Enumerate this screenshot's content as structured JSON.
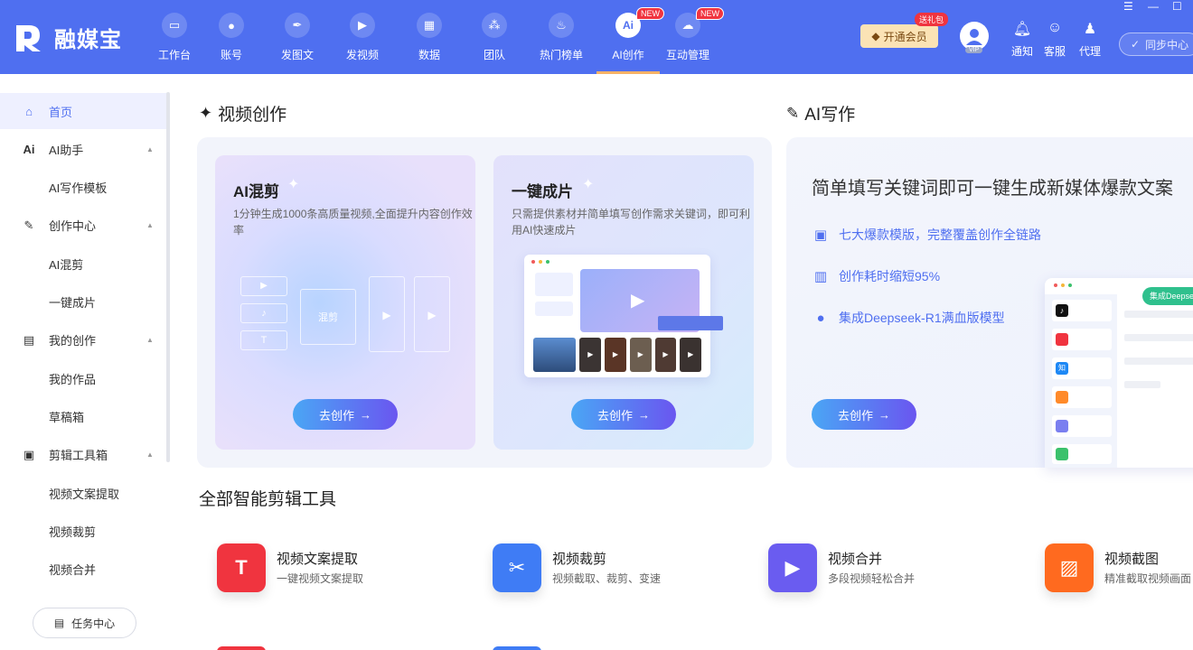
{
  "app": {
    "name": "融媒宝"
  },
  "nav": [
    {
      "label": "工作台",
      "icon": "monitor-icon"
    },
    {
      "label": "账号",
      "icon": "user-icon"
    },
    {
      "label": "发图文",
      "icon": "feather-icon"
    },
    {
      "label": "发视频",
      "icon": "play-icon"
    },
    {
      "label": "数据",
      "icon": "chart-icon"
    },
    {
      "label": "团队",
      "icon": "team-icon"
    },
    {
      "label": "热门榜单",
      "icon": "fire-icon"
    },
    {
      "label": "AI创作",
      "icon": "ai-icon",
      "badge": "NEW",
      "glyph": "Ai"
    },
    {
      "label": "互动管理",
      "icon": "chat-icon",
      "badge": "NEW"
    }
  ],
  "header_right": {
    "vip_label": "开通会员",
    "gift_badge": "送礼包",
    "avatar_badge": "VIP",
    "tools": [
      {
        "label": "通知",
        "icon": "bell-icon"
      },
      {
        "label": "客服",
        "icon": "service-icon"
      },
      {
        "label": "代理",
        "icon": "agent-icon"
      }
    ],
    "sync_label": "同步中心"
  },
  "sidebar": {
    "items": [
      {
        "label": "首页",
        "icon": "home-icon",
        "glyph": "⌂",
        "level": 1,
        "active": true
      },
      {
        "label": "AI助手",
        "icon": "ai-assistant-icon",
        "glyph": "Ai",
        "level": 1,
        "expandable": true
      },
      {
        "label": "AI写作模板",
        "level": 2
      },
      {
        "label": "创作中心",
        "icon": "pen-icon",
        "glyph": "✎",
        "level": 1,
        "expandable": true
      },
      {
        "label": "AI混剪",
        "level": 2
      },
      {
        "label": "一键成片",
        "level": 2
      },
      {
        "label": "我的创作",
        "icon": "document-icon",
        "glyph": "▤",
        "level": 1,
        "expandable": true
      },
      {
        "label": "我的作品",
        "level": 2
      },
      {
        "label": "草稿箱",
        "level": 2
      },
      {
        "label": "剪辑工具箱",
        "icon": "toolbox-icon",
        "glyph": "▣",
        "level": 1,
        "expandable": true
      },
      {
        "label": "视频文案提取",
        "level": 2
      },
      {
        "label": "视频裁剪",
        "level": 2
      },
      {
        "label": "视频合并",
        "level": 2
      }
    ],
    "task_button": "任务中心"
  },
  "video_section": {
    "title": "视频创作",
    "cards": [
      {
        "title": "AI混剪",
        "desc": "1分钟生成1000条高质量视频,全面提升内容创作效率",
        "button": "去创作",
        "preview_label": "混剪"
      },
      {
        "title": "一键成片",
        "desc": "只需提供素材并简单填写创作需求关键词，即可利用AI快速成片",
        "button": "去创作"
      }
    ]
  },
  "ai_section": {
    "title": "AI写作",
    "headline": "简单填写关键词即可一键生成新媒体爆款文案",
    "features": [
      {
        "label": "七大爆款模版，完整覆盖创作全链路",
        "icon": "save-icon"
      },
      {
        "label": "创作耗时缩短95%",
        "icon": "bar-chart-icon"
      },
      {
        "label": "集成Deepseek-R1满血版模型",
        "icon": "bulb-icon"
      }
    ],
    "button": "去创作",
    "preview_tag": "集成Deepse"
  },
  "tools_section": {
    "title": "全部智能剪辑工具",
    "tools": [
      {
        "name": "视频文案提取",
        "desc": "一键视频文案提取",
        "icon": "text-extract-icon",
        "color": "#f0343f",
        "glyph": "T"
      },
      {
        "name": "视频裁剪",
        "desc": "视频截取、裁剪、变速",
        "icon": "scissors-icon",
        "color": "#3f7cf5",
        "glyph": "✂"
      },
      {
        "name": "视频合并",
        "desc": "多段视频轻松合并",
        "icon": "merge-icon",
        "color": "#6a5cf0",
        "glyph": "▶"
      },
      {
        "name": "视频截图",
        "desc": "精准截取视频画面",
        "icon": "screenshot-icon",
        "color": "#ff6a1f",
        "glyph": "▨"
      }
    ]
  }
}
